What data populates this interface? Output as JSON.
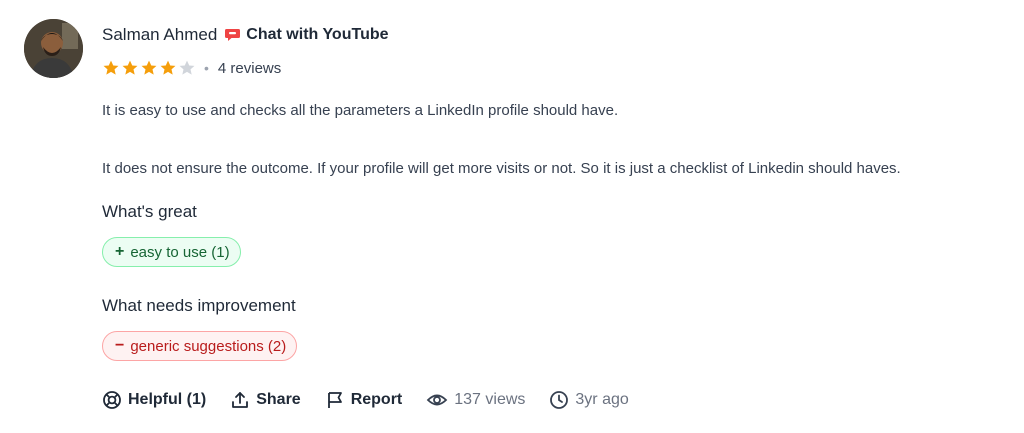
{
  "review": {
    "author": "Salman Ahmed",
    "product": "Chat with YouTube",
    "rating": 4,
    "rating_max": 5,
    "reviews_count": "4 reviews",
    "paragraphs": [
      "It is easy to use and checks all the parameters a LinkedIn profile should have.",
      "It does not ensure the outcome. If your profile will get more visits or not. So it is just a checklist of Linkedin should haves."
    ]
  },
  "great": {
    "heading": "What's great",
    "tags": [
      {
        "sign": "+",
        "label": "easy to use (1)"
      }
    ]
  },
  "improve": {
    "heading": "What needs improvement",
    "tags": [
      {
        "sign": "−",
        "label": "generic suggestions (2)"
      }
    ]
  },
  "actions": {
    "helpful": "Helpful (1)",
    "share": "Share",
    "report": "Report",
    "views": "137 views",
    "time": "3yr ago"
  },
  "colors": {
    "star_filled": "#f59e0b",
    "star_empty": "#d1d5db",
    "product_brand": "#ef4444",
    "good_tag_bg": "#ecfdf3",
    "bad_tag_bg": "#fef2f2"
  },
  "icons": {
    "product": "youtube-chat-logo",
    "helpful": "lifebuoy-icon",
    "share": "share-icon",
    "report": "flag-icon",
    "views": "eye-icon",
    "time": "clock-icon"
  }
}
